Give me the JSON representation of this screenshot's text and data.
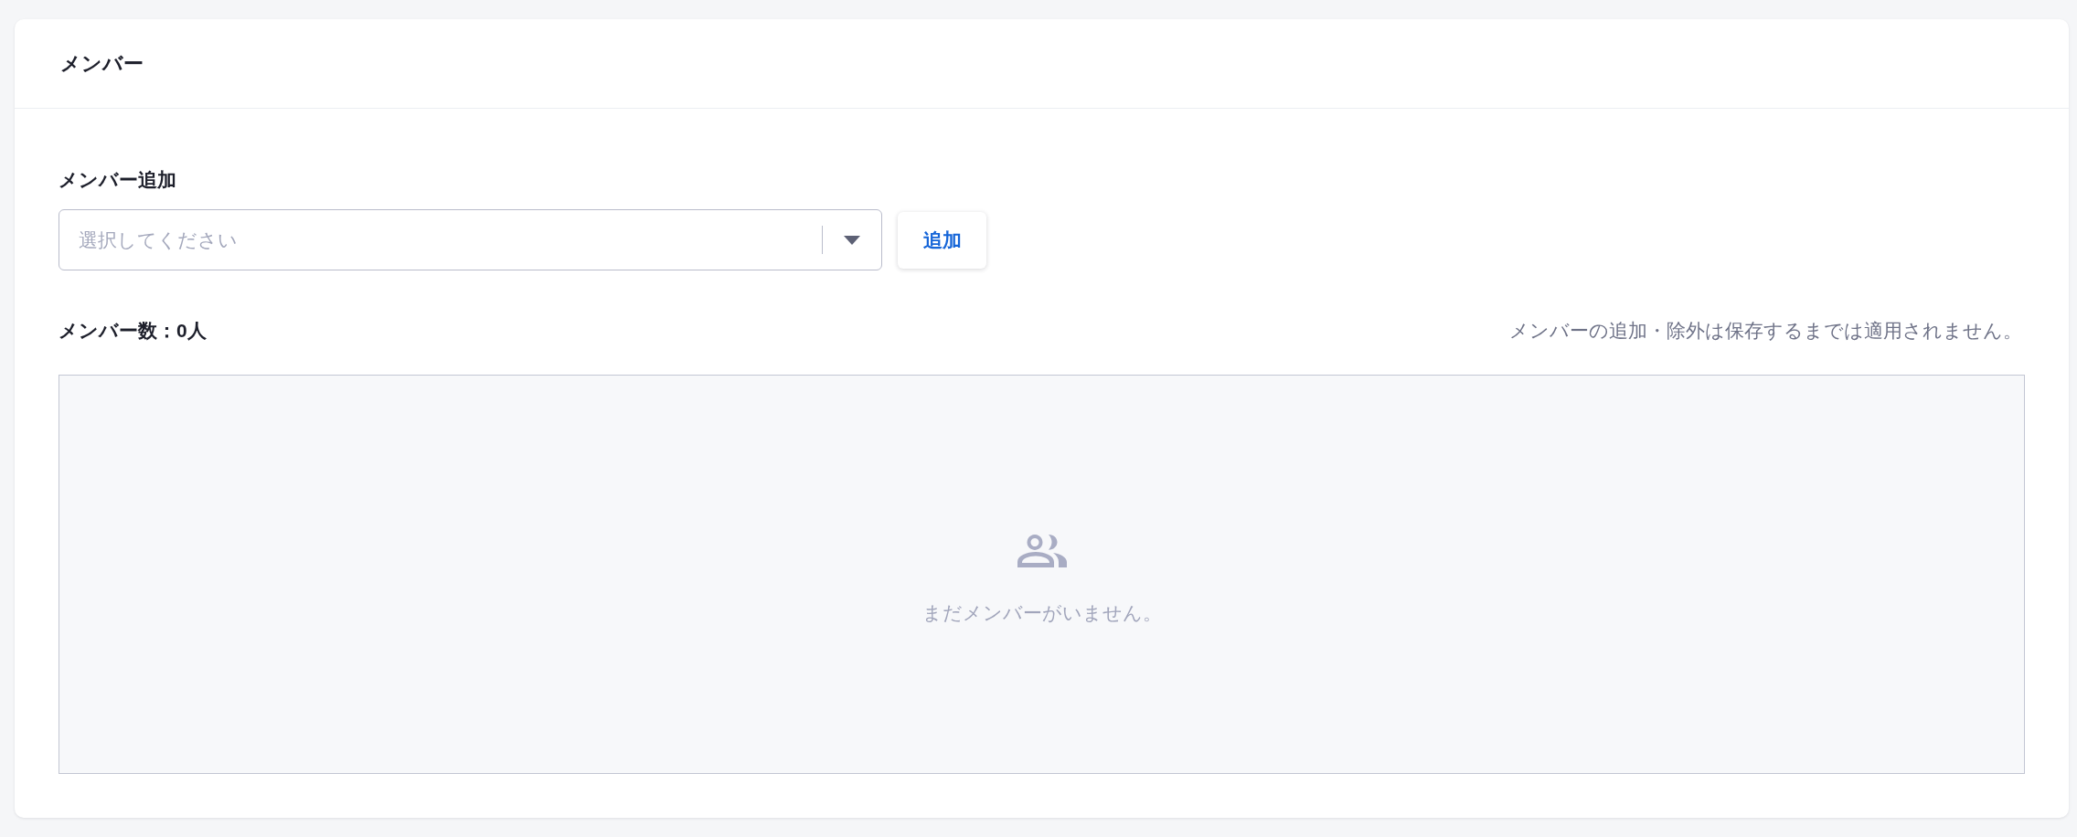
{
  "card": {
    "title": "メンバー"
  },
  "add_member": {
    "label": "メンバー追加",
    "select": {
      "placeholder": "選択してください"
    },
    "button": "追加"
  },
  "member_count": "メンバー数：0人",
  "note": "メンバーの追加・除外は保存するまでは適用されません。",
  "member_list": {
    "empty_message": "まだメンバーがいません。"
  }
}
